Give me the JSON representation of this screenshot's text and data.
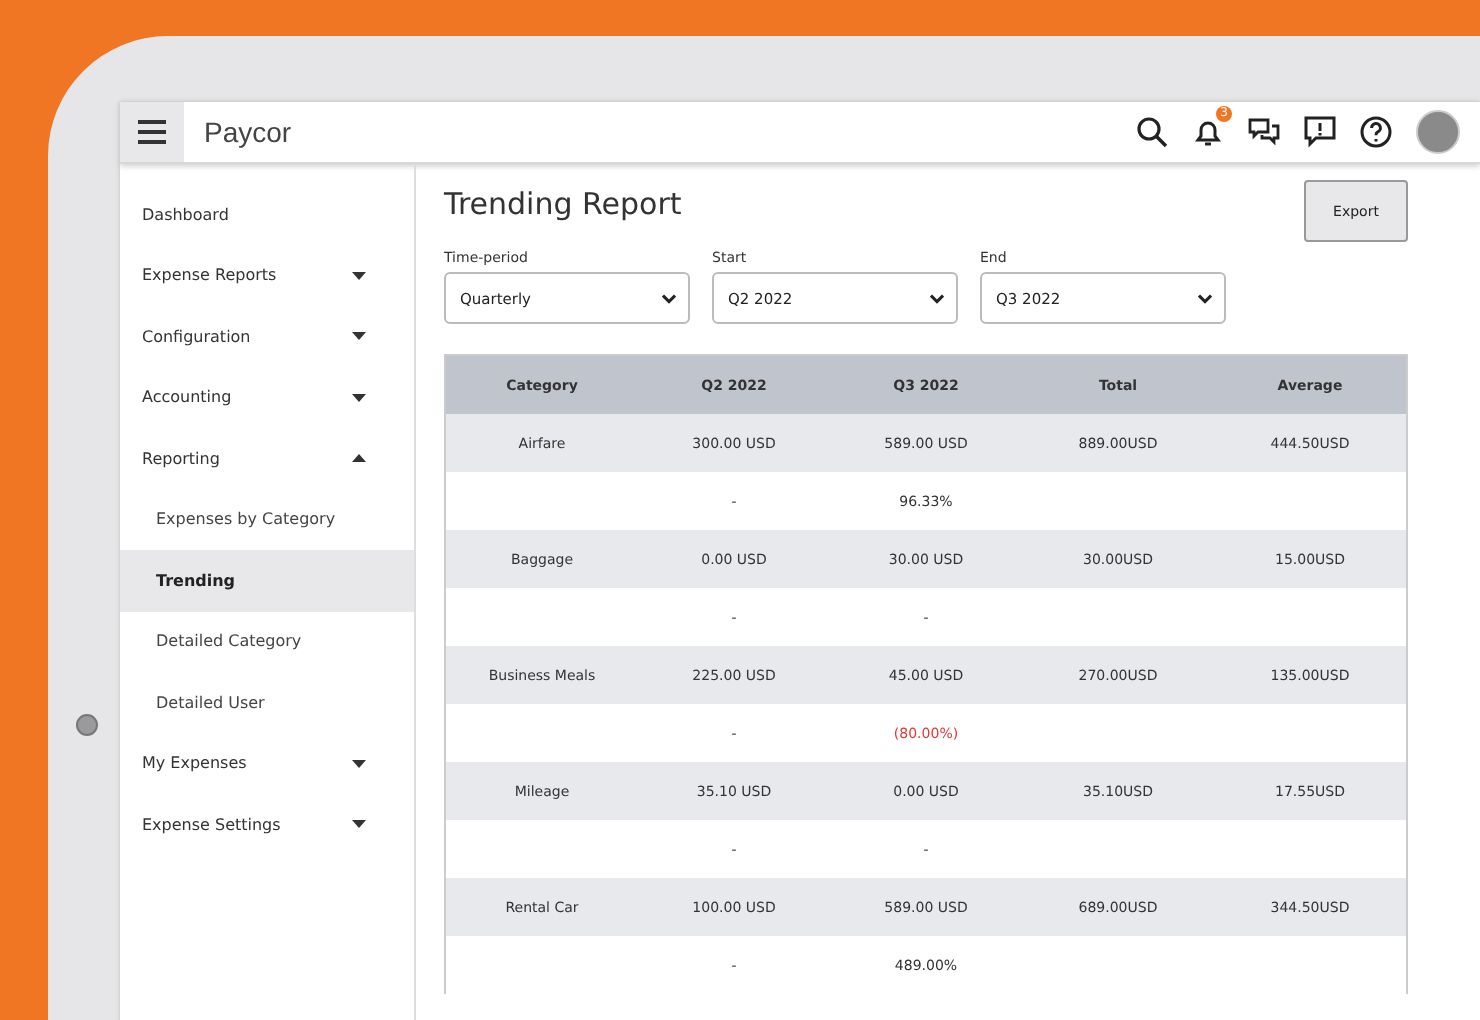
{
  "topbar": {
    "logo": "Paycor",
    "notification_count": "3"
  },
  "sidebar": {
    "items": [
      {
        "label": "Dashboard"
      },
      {
        "label": "Expense Reports",
        "expanded": false
      },
      {
        "label": "Configuration",
        "expanded": false
      },
      {
        "label": "Accounting",
        "expanded": false
      },
      {
        "label": "Reporting",
        "expanded": true,
        "children": [
          {
            "label": "Expenses by Category",
            "selected": false
          },
          {
            "label": "Trending",
            "selected": true
          },
          {
            "label": "Detailed Category",
            "selected": false
          },
          {
            "label": "Detailed User",
            "selected": false
          }
        ]
      },
      {
        "label": "My Expenses",
        "expanded": false
      },
      {
        "label": "Expense Settings",
        "expanded": false
      }
    ]
  },
  "page": {
    "title": "Trending Report",
    "export_button": "Export",
    "filters": [
      {
        "label": "Time-period",
        "value": "Quarterly"
      },
      {
        "label": "Start",
        "value": "Q2 2022"
      },
      {
        "label": "End",
        "value": "Q3 2022"
      }
    ]
  },
  "table": {
    "columns": [
      "Category",
      "Q2 2022",
      "Q3 2022",
      "Total",
      "Average"
    ],
    "rows": [
      {
        "category": "Airfare",
        "q2": "300.00 USD",
        "q3": "589.00 USD",
        "total": "889.00USD",
        "average": "444.50USD",
        "q2_change": "-",
        "q3_change": "96.33%",
        "negative": false
      },
      {
        "category": "Baggage",
        "q2": "0.00 USD",
        "q3": "30.00 USD",
        "total": "30.00USD",
        "average": "15.00USD",
        "q2_change": "-",
        "q3_change": "-",
        "negative": false
      },
      {
        "category": "Business Meals",
        "q2": "225.00 USD",
        "q3": "45.00 USD",
        "total": "270.00USD",
        "average": "135.00USD",
        "q2_change": "-",
        "q3_change": "(80.00%)",
        "negative": true
      },
      {
        "category": "Mileage",
        "q2": "35.10 USD",
        "q3": "0.00 USD",
        "total": "35.10USD",
        "average": "17.55USD",
        "q2_change": "-",
        "q3_change": "-",
        "negative": false
      },
      {
        "category": "Rental Car",
        "q2": "100.00 USD",
        "q3": "589.00 USD",
        "total": "689.00USD",
        "average": "344.50USD",
        "q2_change": "-",
        "q3_change": "489.00%",
        "negative": false
      }
    ]
  }
}
